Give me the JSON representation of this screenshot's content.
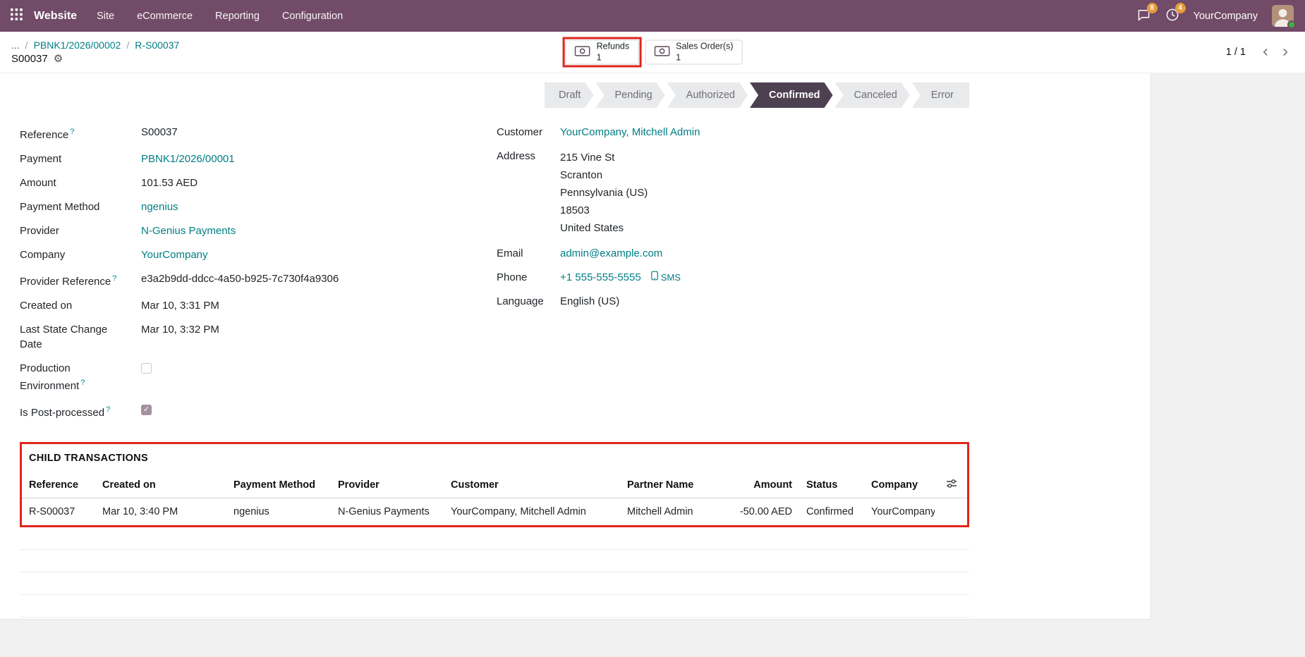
{
  "topbar": {
    "brand": "Website",
    "menus": [
      "Site",
      "eCommerce",
      "Reporting",
      "Configuration"
    ],
    "messages_badge": "8",
    "activities_badge": "4",
    "user_company": "YourCompany"
  },
  "control_panel": {
    "breadcrumb_ellipsis": "...",
    "breadcrumb_items": [
      "PBNK1/2026/00002",
      "R-S00037"
    ],
    "record_title": "S00037",
    "smart_buttons": [
      {
        "label": "Refunds",
        "count": "1"
      },
      {
        "label": "Sales Order(s)",
        "count": "1"
      }
    ],
    "pager": "1 / 1"
  },
  "statusbar": {
    "steps": [
      "Draft",
      "Pending",
      "Authorized",
      "Confirmed",
      "Canceled",
      "Error"
    ],
    "active_step": "Confirmed"
  },
  "fields_left": [
    {
      "label": "Reference",
      "help": "?",
      "value": "S00037"
    },
    {
      "label": "Payment",
      "value": "PBNK1/2026/00001"
    },
    {
      "label": "Amount",
      "value": "101.53 AED"
    },
    {
      "label": "Payment Method",
      "value": "ngenius"
    },
    {
      "label": "Provider",
      "value": "N-Genius Payments"
    },
    {
      "label": "Company",
      "value": "YourCompany"
    },
    {
      "label": "Provider Reference",
      "help": "?",
      "value": "e3a2b9dd-ddcc-4a50-b925-7c730f4a9306"
    },
    {
      "label": "Created on",
      "value": "Mar 10, 3:31 PM"
    },
    {
      "label": "Last State Change Date",
      "value": "Mar 10, 3:32 PM"
    },
    {
      "label": "Production Environment",
      "help": "?",
      "checked": false
    },
    {
      "label": "Is Post-processed",
      "help": "?",
      "checked": true
    }
  ],
  "fields_right": {
    "customer_label": "Customer",
    "customer_value": "YourCompany, Mitchell Admin",
    "address_label": "Address",
    "address_lines": [
      "215 Vine St",
      "Scranton",
      "Pennsylvania (US)",
      "18503",
      "United States"
    ],
    "email_label": "Email",
    "email_value": "admin@example.com",
    "phone_label": "Phone",
    "phone_value": "+1 555-555-5555",
    "sms_label": "SMS",
    "language_label": "Language",
    "language_value": "English (US)"
  },
  "child_transactions": {
    "title": "CHILD TRANSACTIONS",
    "columns": [
      "Reference",
      "Created on",
      "Payment Method",
      "Provider",
      "Customer",
      "Partner Name",
      "Amount",
      "Status",
      "Company"
    ],
    "rows": [
      {
        "reference": "R-S00037",
        "created_on": "Mar 10, 3:40 PM",
        "payment_method": "ngenius",
        "provider": "N-Genius Payments",
        "customer": "YourCompany, Mitchell Admin",
        "partner_name": "Mitchell Admin",
        "amount": "-50.00 AED",
        "status": "Confirmed",
        "company": "YourCompany"
      }
    ]
  },
  "annotations": {
    "refunds_button_outlined": true,
    "child_transactions_outlined": true,
    "outline_color": "#e0251c"
  },
  "colors": {
    "topbar": "#714B67",
    "link": "#017e84",
    "badge": "#e79b3c",
    "status_active": "#4d4050"
  }
}
